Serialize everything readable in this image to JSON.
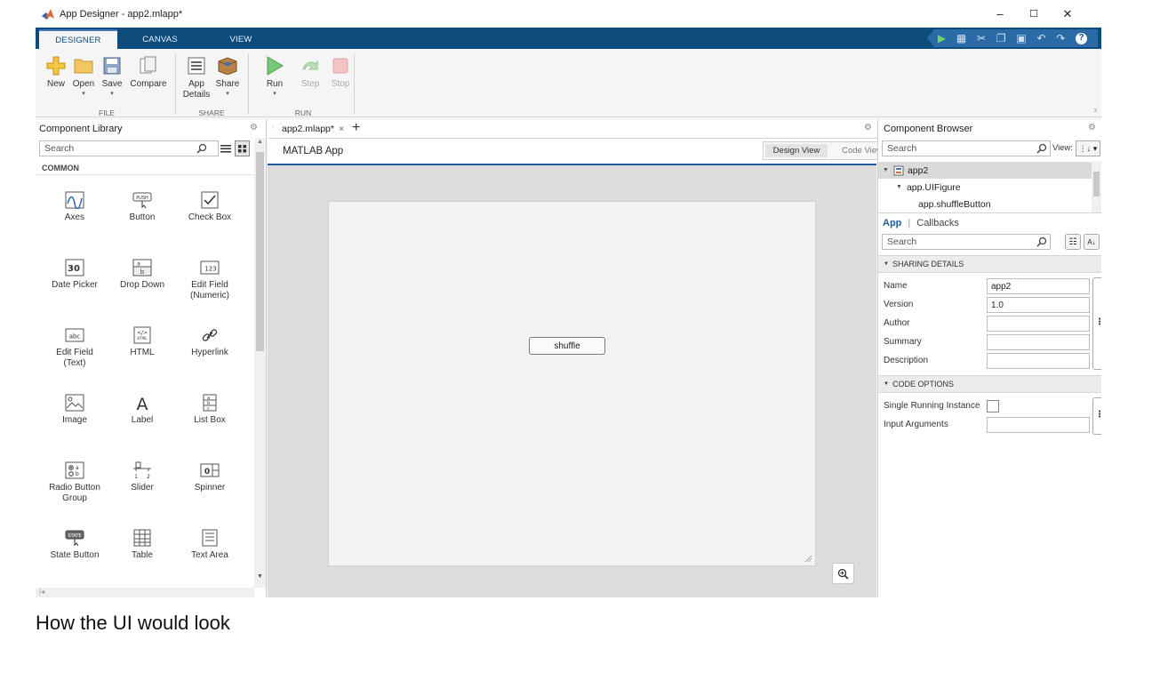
{
  "window": {
    "title": "App Designer - app2.mlapp*",
    "minimize": "–",
    "maximize": "☐",
    "close": "✕"
  },
  "tabs": [
    {
      "label": "DESIGNER",
      "active": true
    },
    {
      "label": "CANVAS",
      "active": false
    },
    {
      "label": "VIEW",
      "active": false
    }
  ],
  "quick_access": [
    "run-icon",
    "save-icon",
    "cut-icon",
    "copy-icon",
    "paste-icon",
    "undo-icon",
    "redo-icon",
    "help-icon"
  ],
  "ribbon": {
    "new": "New",
    "open": "Open",
    "save": "Save",
    "compare": "Compare",
    "app_details_1": "App",
    "app_details_2": "Details",
    "share": "Share",
    "run": "Run",
    "step": "Step",
    "stop": "Stop",
    "group_file": "FILE",
    "group_share": "SHARE",
    "group_run": "RUN",
    "arrow": "▾"
  },
  "library": {
    "title": "Component Library",
    "search_placeholder": "Search",
    "category": "COMMON",
    "items": [
      {
        "label": "Axes"
      },
      {
        "label": "Button"
      },
      {
        "label": "Check Box"
      },
      {
        "label": "Date Picker"
      },
      {
        "label": "Drop Down"
      },
      {
        "label": "Edit Field\n(Numeric)"
      },
      {
        "label": "Edit Field\n(Text)"
      },
      {
        "label": "HTML"
      },
      {
        "label": "Hyperlink"
      },
      {
        "label": "Image"
      },
      {
        "label": "Label"
      },
      {
        "label": "List Box"
      },
      {
        "label": "Radio Button\nGroup"
      },
      {
        "label": "Slider"
      },
      {
        "label": "Spinner"
      },
      {
        "label": "State Button"
      },
      {
        "label": "Table"
      },
      {
        "label": "Text Area"
      }
    ]
  },
  "editor": {
    "doc_tab": "app2.mlapp*",
    "close_glyph": "×",
    "add_glyph": "+",
    "app_title": "MATLAB App",
    "design_view": "Design View",
    "code_view": "Code View",
    "button_text": "shuffle"
  },
  "browser": {
    "title": "Component Browser",
    "search_placeholder": "Search",
    "view_label": "View:",
    "tree": [
      "app2",
      "app.UIFigure",
      "app.shuffleButton"
    ],
    "tab_app": "App",
    "tab_sep": "|",
    "tab_callbacks": "Callbacks",
    "prop_search_placeholder": "Search",
    "sharing_header": "SHARING DETAILS",
    "code_header": "CODE OPTIONS",
    "props": {
      "name_label": "Name",
      "name_value": "app2",
      "version_label": "Version",
      "version_value": "1.0",
      "author_label": "Author",
      "author_value": "",
      "summary_label": "Summary",
      "summary_value": "",
      "description_label": "Description",
      "description_value": "",
      "single_label": "Single Running Instance",
      "input_label": "Input Arguments",
      "input_value": ""
    }
  },
  "caption": "How the UI would look"
}
